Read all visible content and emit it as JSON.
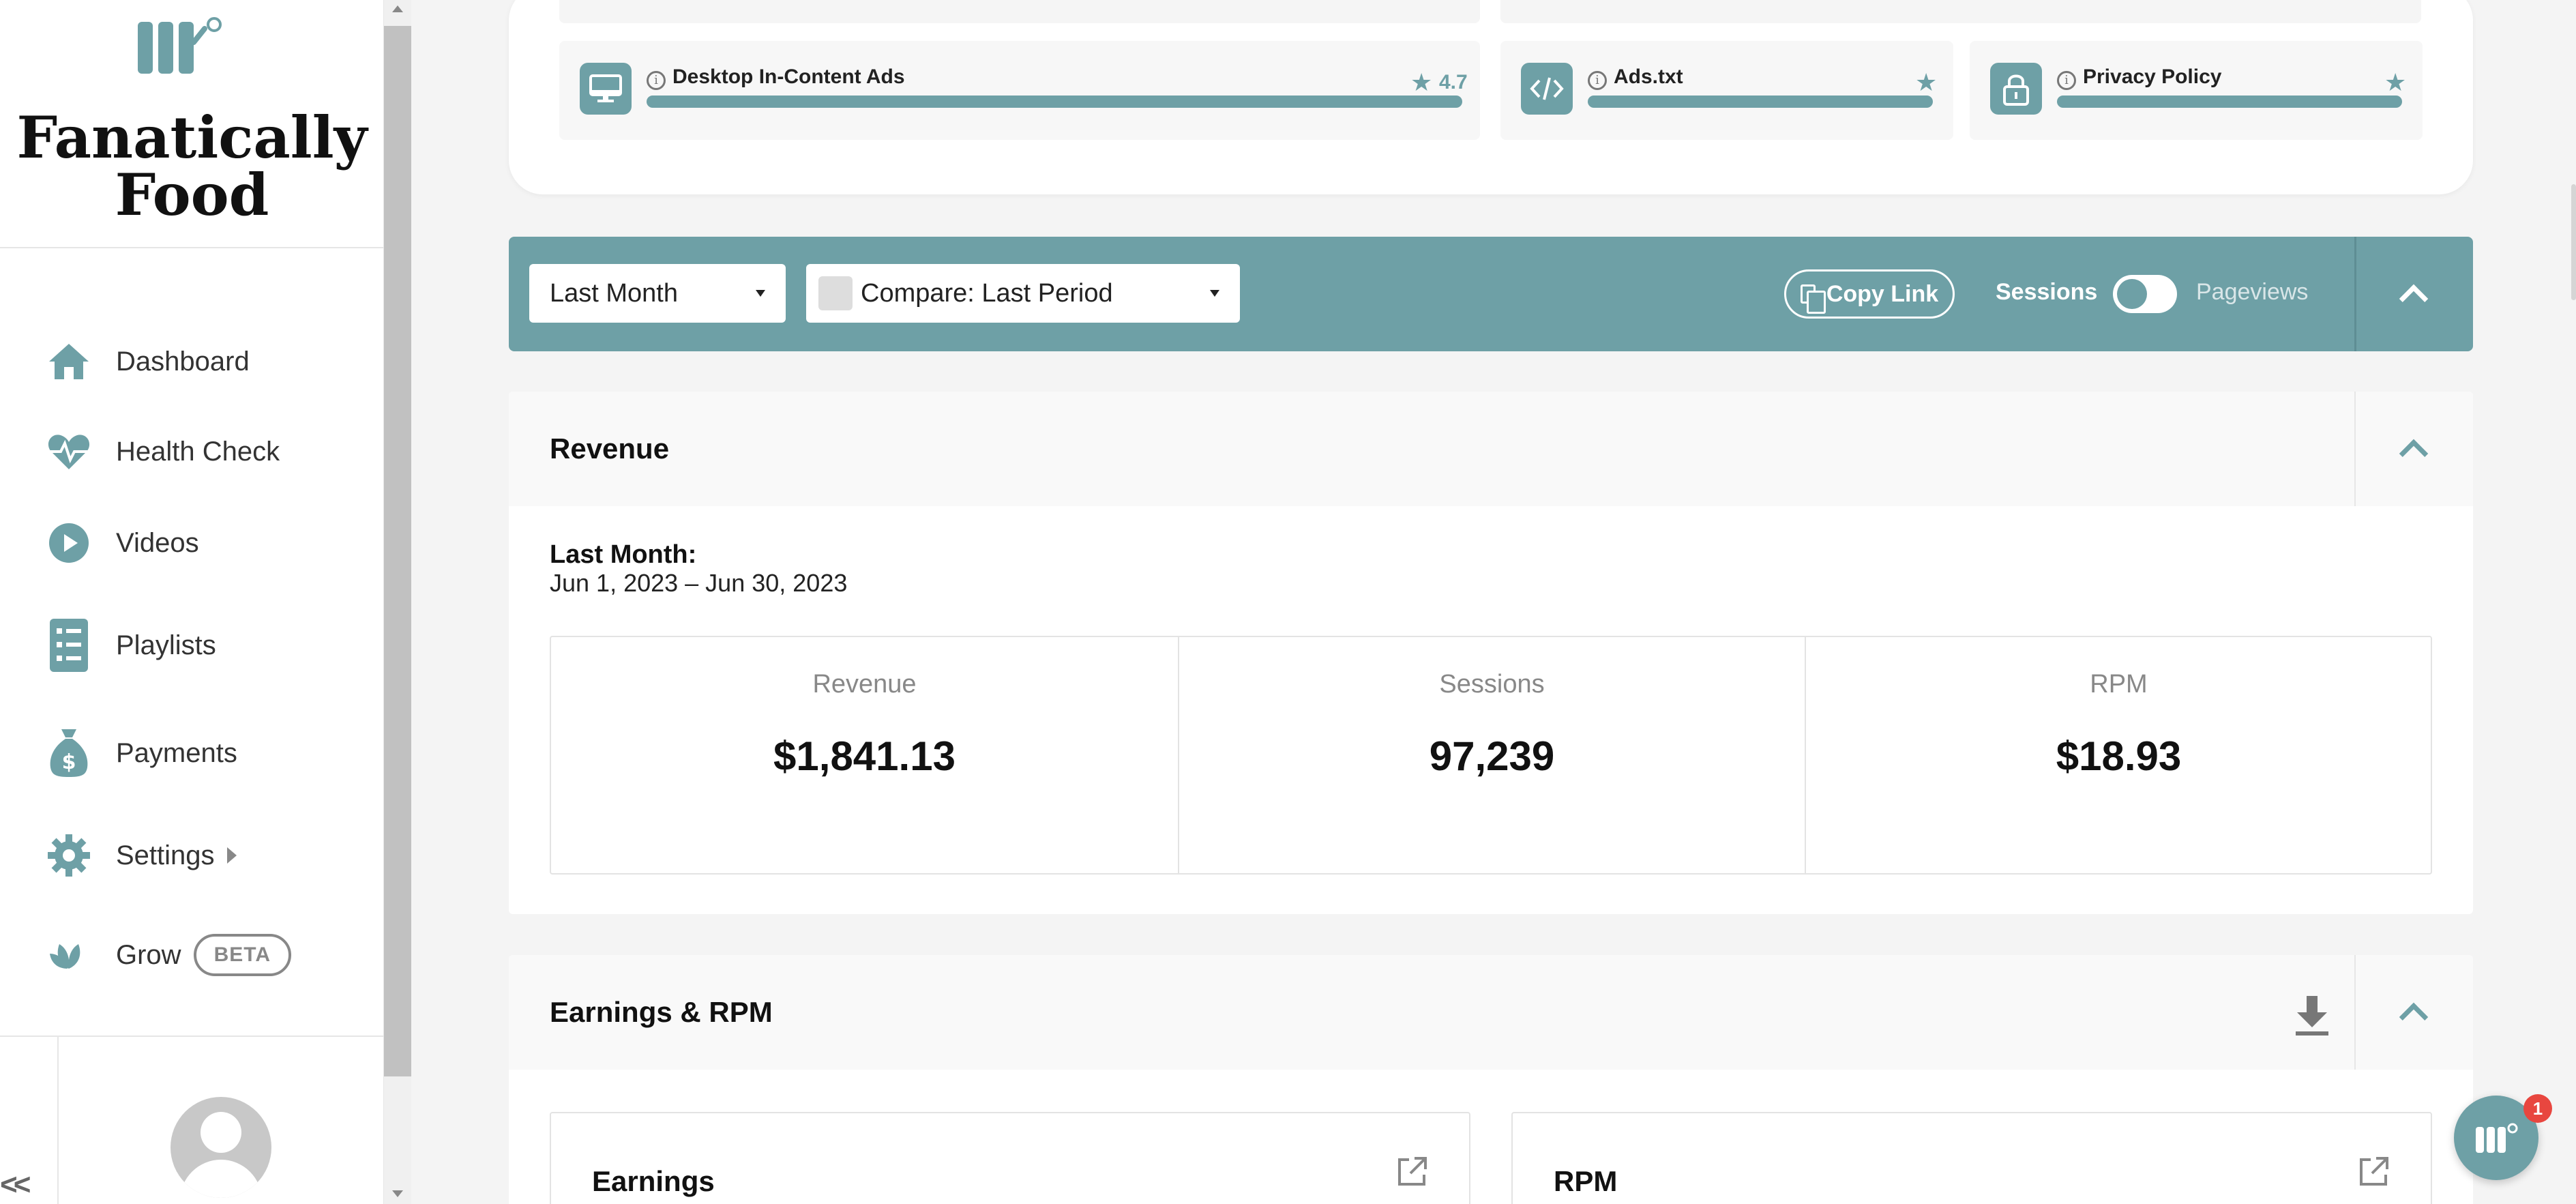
{
  "brand": {
    "name": "Fanatically Food",
    "logo": "mediavine-m-logo",
    "accent": "#6ea0a6"
  },
  "sidebar": {
    "items": [
      {
        "label": "Dashboard",
        "icon": "home-icon"
      },
      {
        "label": "Health Check",
        "icon": "heartbeat-icon"
      },
      {
        "label": "Videos",
        "icon": "play-circle-icon"
      },
      {
        "label": "Playlists",
        "icon": "list-icon"
      },
      {
        "label": "Payments",
        "icon": "money-bag-icon"
      },
      {
        "label": "Settings",
        "icon": "gear-icon"
      },
      {
        "label": "Grow",
        "icon": "leaf-icon",
        "badge": "BETA"
      }
    ],
    "collapse": "<<"
  },
  "health_checks": [
    {
      "title": "Desktop In-Content Ads",
      "rating": "4.7",
      "icon": "desktop-icon"
    },
    {
      "title": "Ads.txt",
      "icon": "code-icon"
    },
    {
      "title": "Privacy Policy",
      "icon": "lock-icon"
    }
  ],
  "filters": {
    "date_range": "Last Month",
    "compare": "Compare: Last Period",
    "copy_link": "Copy Link",
    "toggle_left": "Sessions",
    "toggle_right": "Pageviews"
  },
  "revenue": {
    "title": "Revenue",
    "period_label": "Last Month:",
    "period_range": "Jun 1, 2023 – Jun 30, 2023",
    "stats": [
      {
        "label": "Revenue",
        "value": "$1,841.13"
      },
      {
        "label": "Sessions",
        "value": "97,239"
      },
      {
        "label": "RPM",
        "value": "$18.93"
      }
    ]
  },
  "earnings": {
    "title": "Earnings & RPM",
    "cards": [
      {
        "title": "Earnings"
      },
      {
        "title": "RPM"
      }
    ]
  },
  "chat": {
    "badge": "1"
  }
}
